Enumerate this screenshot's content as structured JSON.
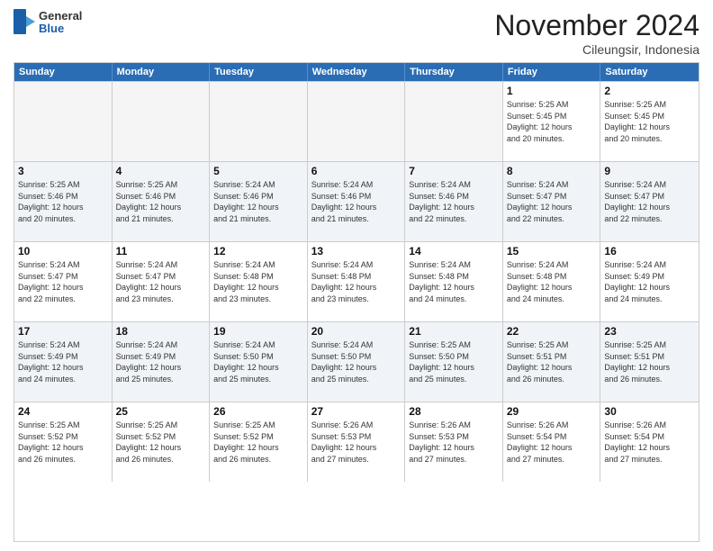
{
  "header": {
    "logo": {
      "general": "General",
      "blue": "Blue"
    },
    "title": "November 2024",
    "location": "Cileungsir, Indonesia"
  },
  "days_header": [
    "Sunday",
    "Monday",
    "Tuesday",
    "Wednesday",
    "Thursday",
    "Friday",
    "Saturday"
  ],
  "weeks": [
    [
      {
        "day": "",
        "info": "",
        "empty": true
      },
      {
        "day": "",
        "info": "",
        "empty": true
      },
      {
        "day": "",
        "info": "",
        "empty": true
      },
      {
        "day": "",
        "info": "",
        "empty": true
      },
      {
        "day": "",
        "info": "",
        "empty": true
      },
      {
        "day": "1",
        "info": "Sunrise: 5:25 AM\nSunset: 5:45 PM\nDaylight: 12 hours\nand 20 minutes."
      },
      {
        "day": "2",
        "info": "Sunrise: 5:25 AM\nSunset: 5:45 PM\nDaylight: 12 hours\nand 20 minutes."
      }
    ],
    [
      {
        "day": "3",
        "info": "Sunrise: 5:25 AM\nSunset: 5:46 PM\nDaylight: 12 hours\nand 20 minutes."
      },
      {
        "day": "4",
        "info": "Sunrise: 5:25 AM\nSunset: 5:46 PM\nDaylight: 12 hours\nand 21 minutes."
      },
      {
        "day": "5",
        "info": "Sunrise: 5:24 AM\nSunset: 5:46 PM\nDaylight: 12 hours\nand 21 minutes."
      },
      {
        "day": "6",
        "info": "Sunrise: 5:24 AM\nSunset: 5:46 PM\nDaylight: 12 hours\nand 21 minutes."
      },
      {
        "day": "7",
        "info": "Sunrise: 5:24 AM\nSunset: 5:46 PM\nDaylight: 12 hours\nand 22 minutes."
      },
      {
        "day": "8",
        "info": "Sunrise: 5:24 AM\nSunset: 5:47 PM\nDaylight: 12 hours\nand 22 minutes."
      },
      {
        "day": "9",
        "info": "Sunrise: 5:24 AM\nSunset: 5:47 PM\nDaylight: 12 hours\nand 22 minutes."
      }
    ],
    [
      {
        "day": "10",
        "info": "Sunrise: 5:24 AM\nSunset: 5:47 PM\nDaylight: 12 hours\nand 22 minutes."
      },
      {
        "day": "11",
        "info": "Sunrise: 5:24 AM\nSunset: 5:47 PM\nDaylight: 12 hours\nand 23 minutes."
      },
      {
        "day": "12",
        "info": "Sunrise: 5:24 AM\nSunset: 5:48 PM\nDaylight: 12 hours\nand 23 minutes."
      },
      {
        "day": "13",
        "info": "Sunrise: 5:24 AM\nSunset: 5:48 PM\nDaylight: 12 hours\nand 23 minutes."
      },
      {
        "day": "14",
        "info": "Sunrise: 5:24 AM\nSunset: 5:48 PM\nDaylight: 12 hours\nand 24 minutes."
      },
      {
        "day": "15",
        "info": "Sunrise: 5:24 AM\nSunset: 5:48 PM\nDaylight: 12 hours\nand 24 minutes."
      },
      {
        "day": "16",
        "info": "Sunrise: 5:24 AM\nSunset: 5:49 PM\nDaylight: 12 hours\nand 24 minutes."
      }
    ],
    [
      {
        "day": "17",
        "info": "Sunrise: 5:24 AM\nSunset: 5:49 PM\nDaylight: 12 hours\nand 24 minutes."
      },
      {
        "day": "18",
        "info": "Sunrise: 5:24 AM\nSunset: 5:49 PM\nDaylight: 12 hours\nand 25 minutes."
      },
      {
        "day": "19",
        "info": "Sunrise: 5:24 AM\nSunset: 5:50 PM\nDaylight: 12 hours\nand 25 minutes."
      },
      {
        "day": "20",
        "info": "Sunrise: 5:24 AM\nSunset: 5:50 PM\nDaylight: 12 hours\nand 25 minutes."
      },
      {
        "day": "21",
        "info": "Sunrise: 5:25 AM\nSunset: 5:50 PM\nDaylight: 12 hours\nand 25 minutes."
      },
      {
        "day": "22",
        "info": "Sunrise: 5:25 AM\nSunset: 5:51 PM\nDaylight: 12 hours\nand 26 minutes."
      },
      {
        "day": "23",
        "info": "Sunrise: 5:25 AM\nSunset: 5:51 PM\nDaylight: 12 hours\nand 26 minutes."
      }
    ],
    [
      {
        "day": "24",
        "info": "Sunrise: 5:25 AM\nSunset: 5:52 PM\nDaylight: 12 hours\nand 26 minutes."
      },
      {
        "day": "25",
        "info": "Sunrise: 5:25 AM\nSunset: 5:52 PM\nDaylight: 12 hours\nand 26 minutes."
      },
      {
        "day": "26",
        "info": "Sunrise: 5:25 AM\nSunset: 5:52 PM\nDaylight: 12 hours\nand 26 minutes."
      },
      {
        "day": "27",
        "info": "Sunrise: 5:26 AM\nSunset: 5:53 PM\nDaylight: 12 hours\nand 27 minutes."
      },
      {
        "day": "28",
        "info": "Sunrise: 5:26 AM\nSunset: 5:53 PM\nDaylight: 12 hours\nand 27 minutes."
      },
      {
        "day": "29",
        "info": "Sunrise: 5:26 AM\nSunset: 5:54 PM\nDaylight: 12 hours\nand 27 minutes."
      },
      {
        "day": "30",
        "info": "Sunrise: 5:26 AM\nSunset: 5:54 PM\nDaylight: 12 hours\nand 27 minutes."
      }
    ]
  ]
}
